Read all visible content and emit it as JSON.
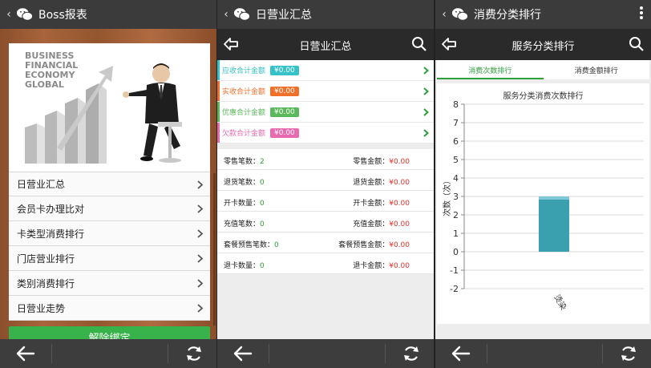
{
  "panels": [
    {
      "wechat_title": "Boss报表",
      "banner_text": [
        "BUSINESS",
        "FINANCIAL",
        "ECONOMY",
        "GLOBAL"
      ],
      "menu": [
        "日营业汇总",
        "会员卡办理比对",
        "卡类型消费排行",
        "门店营业排行",
        "类别消费排行",
        "日营业走势"
      ],
      "green_button": "解除绑定"
    },
    {
      "wechat_title": "日营业汇总",
      "header_title": "日营业汇总",
      "summary": [
        {
          "label": "应收合计金额",
          "value": "¥0.00",
          "color": "#35c2c8"
        },
        {
          "label": "实收合计金额",
          "value": "¥0.00",
          "color": "#f0702a"
        },
        {
          "label": "优惠合计金额",
          "value": "¥0.00",
          "color": "#5cb85c"
        },
        {
          "label": "欠款合计金额",
          "value": "¥0.00",
          "color": "#e86bb0"
        }
      ],
      "stats": [
        {
          "left_label": "零售笔数：",
          "left_value": "2",
          "right_label": "零售金额：",
          "right_value": "¥0.00"
        },
        {
          "left_label": "退货笔数：",
          "left_value": "0",
          "right_label": "退货金额：",
          "right_value": "¥0.00"
        },
        {
          "left_label": "开卡数量：",
          "left_value": "0",
          "right_label": "开卡金额：",
          "right_value": "¥0.00"
        },
        {
          "left_label": "充值笔数：",
          "left_value": "0",
          "right_label": "充值金额：",
          "right_value": "¥0.00"
        },
        {
          "left_label": "套餐预售笔数：",
          "left_value": "0",
          "right_label": "套餐预售金额：",
          "right_value": "¥0.00"
        },
        {
          "left_label": "退卡数量：",
          "left_value": "0",
          "right_label": "退卡金额：",
          "right_value": "¥0.00"
        }
      ]
    },
    {
      "wechat_title": "消费分类排行",
      "header_title": "服务分类排行",
      "tabs": [
        "消费次数排行",
        "消费金额排行"
      ]
    }
  ],
  "chart_data": {
    "type": "bar",
    "title": "服务分类消费次数排行",
    "ylabel": "次数（次）",
    "xlabel": "",
    "categories": [
      "烫染"
    ],
    "values": [
      3
    ],
    "ylim": [
      -2,
      8
    ],
    "yticks": [
      8,
      7,
      6,
      5,
      4,
      3,
      2,
      1,
      0,
      -1,
      -2
    ],
    "grid": true,
    "bar_color": "#3aa0b0"
  },
  "colors": {
    "accent_green": "#38b24a",
    "title_bar": "#3b3b3b",
    "header": "#2a2a2a",
    "value_green": "#2e9e3a",
    "value_red": "#e0322b"
  }
}
